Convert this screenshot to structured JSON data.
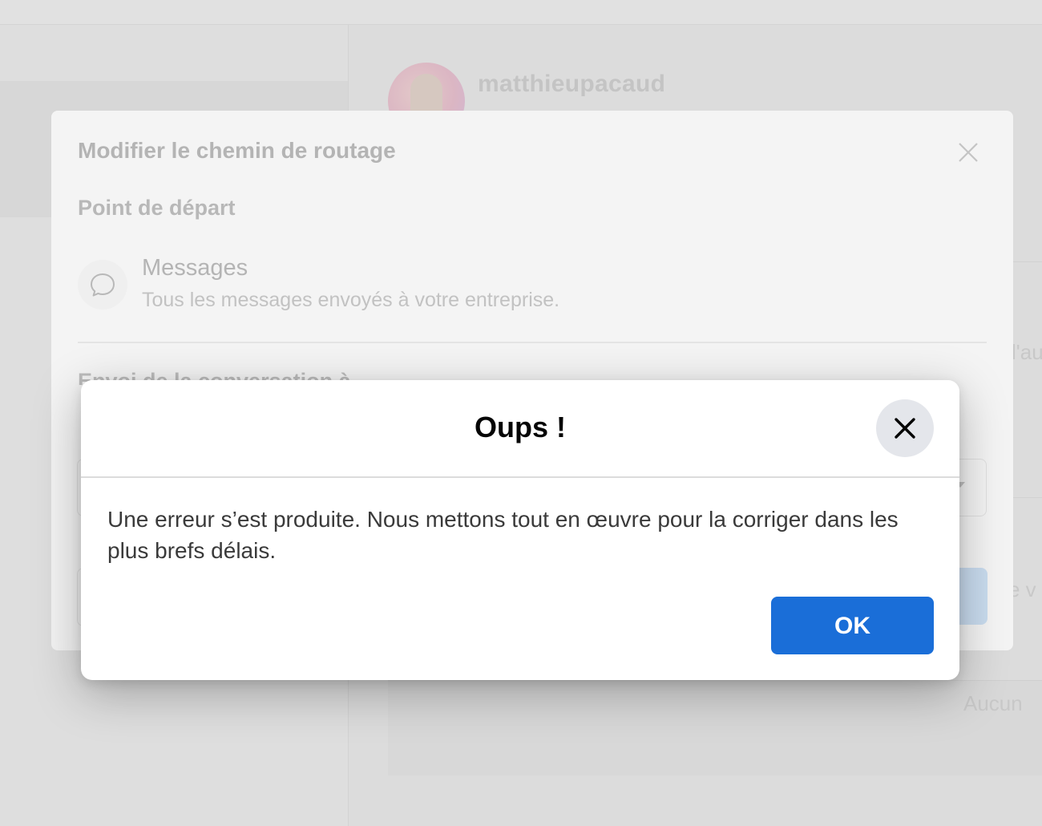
{
  "background": {
    "username": "matthieupacaud",
    "side_text_top": "l'au",
    "side_text_mid": "e v",
    "side_text_bottom": "Aucun"
  },
  "routing_modal": {
    "title": "Modifier le chemin de routage",
    "section_start": "Point de départ",
    "item": {
      "icon": "chat-bubble-icon",
      "title": "Messages",
      "subtitle": "Tous les messages envoyés à votre entreprise."
    },
    "section_next": "Envoi de la conversation à"
  },
  "error_dialog": {
    "title": "Oups !",
    "message": "Une erreur s’est produite. Nous mettons tout en œuvre pour la corriger dans les plus brefs délais.",
    "ok_label": "OK",
    "accent_color": "#1a6ed8"
  }
}
